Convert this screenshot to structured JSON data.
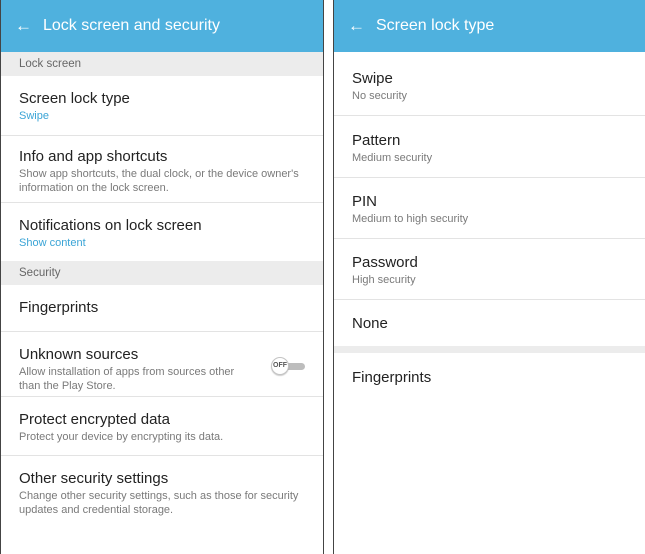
{
  "theme": {
    "accent": "#4fb1de",
    "subtext_accent": "#3aa4d6"
  },
  "left": {
    "title": "Lock screen and security",
    "back_icon": "arrow-back-icon",
    "sections": [
      {
        "label": "Lock screen"
      },
      {
        "label": "Security"
      }
    ],
    "items": [
      {
        "title": "Screen lock type",
        "subtitle": "Swipe"
      },
      {
        "title": "Info and app shortcuts",
        "subtitle": "Show app shortcuts, the dual clock, or the device owner's information on the lock screen."
      },
      {
        "title": "Notifications on lock screen",
        "subtitle": "Show content"
      },
      {
        "title": "Fingerprints"
      },
      {
        "title": "Unknown sources",
        "subtitle": "Allow installation of apps from sources other than the Play Store.",
        "toggle": "OFF"
      },
      {
        "title": "Protect encrypted data",
        "subtitle": "Protect your device by encrypting its data."
      },
      {
        "title": "Other security settings",
        "subtitle": "Change other security settings, such as those for security updates and credential storage."
      }
    ]
  },
  "right": {
    "title": "Screen lock type",
    "back_icon": "arrow-back-icon",
    "items": [
      {
        "title": "Swipe",
        "subtitle": "No security"
      },
      {
        "title": "Pattern",
        "subtitle": "Medium security"
      },
      {
        "title": "PIN",
        "subtitle": "Medium to high security"
      },
      {
        "title": "Password",
        "subtitle": "High security"
      },
      {
        "title": "None"
      },
      {
        "title": "Fingerprints"
      }
    ]
  }
}
